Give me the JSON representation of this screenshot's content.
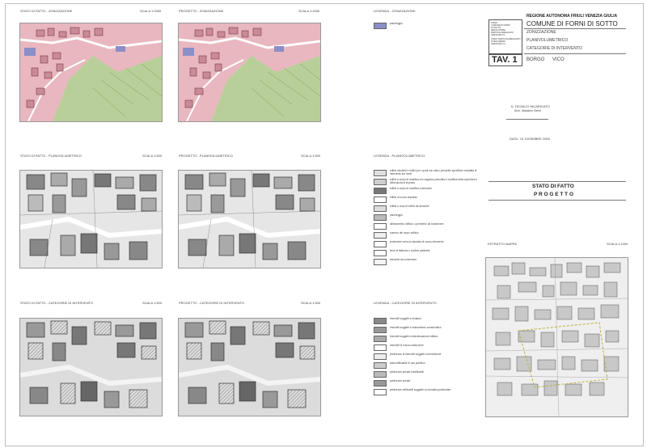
{
  "sheet": {
    "panels": {
      "zon_sf_title": "STATO DI FATTO - ZONIZZAZIONE",
      "zon_sf_scale": "SCALA 1:2000",
      "zon_pr_title": "PROGETTO - ZONIZZAZIONE",
      "zon_pr_scale": "SCALA 1:2000",
      "pv_sf_title": "STATO DI FATTO - PLANIVOLUMETRICO",
      "pv_sf_scale": "SCALA 1:500",
      "pv_pr_title": "PROGETTO - PLANIVOLUMETRICO",
      "pv_pr_scale": "SCALA 1:500",
      "ci_sf_title": "STATO DI FATTO - CATEGORIE DI INTERVENTO",
      "ci_sf_scale": "SCALA 1:500",
      "ci_pr_title": "PROGETTO - CATEGORIE DI INTERVENTO",
      "ci_pr_scale": "SCALA 1:500"
    },
    "legends": {
      "zon_title": "LEGENDA - ZONIZZAZIONE",
      "zon_items": [
        "parcheggio"
      ],
      "pv_title": "LEGENDA - PLANIVOLUMETRICO",
      "pv_items": [
        "edifici esistenti e edifici per i quali non siano prescritte specifiche modalità di intervento sui fronti",
        "edifici a corpo di modifica con sagoma prescritta e modifica della copertura e della quota di imposta",
        "edifici a corpo di modifica costruzioni",
        "edifici di nuovo impianto",
        "edifici o corpi di edifici da demolire",
        "parcheggio",
        "allineamento edificio o perimetro da mantenere",
        "numero del corpo edificio",
        "protezione verso la facciata di nuovo intervento",
        "linee di fabbrica e confine particelle",
        "elementi da conservare"
      ],
      "ci_title": "LEGENDA - CATEGORIE DI INTERVENTO",
      "ci_items": [
        "immobili soggetti a restauro",
        "immobili soggetti a risanamento conservativo",
        "immobili soggetti a ristrutturazione edilizia",
        "immobili di nuova costruzione",
        "pertinenze di immobili soggetti a demolizione",
        "area edificabile di uso pubblico",
        "pertinenze private inedificabili",
        "pertinenze private",
        "pertinenze edificabili soggette a normativa particolare"
      ]
    },
    "titleblock": {
      "logo_lines": [
        "PIANO",
        "COMUNE DI FORNI",
        "DI SOTTO",
        "REGOLATORE",
        "PARTICOLAREGGIATO",
        "VARIANTE N.1"
      ],
      "logo_lines2": [
        "PIANO PARTICOLAREGGIATO",
        "DI RECUPERO",
        "VARIANTE N.2"
      ],
      "tav": "TAV. 1",
      "region": "REGIONE AUTONOMA FRIULI VENEZIA GIULIA",
      "comune": "COMUNE DI FORNI DI SOTTO",
      "line1": "ZONIZZAZIONE",
      "line2": "PLANIVOLUMETRICO",
      "line3": "CATEGORIE DI INTERVENTO",
      "borgo": "BORGO",
      "vico": "VICO",
      "tecnico_label": "IL TECNICO INCARICATO",
      "tecnico_name": "Arch. Massimo Serini",
      "data": "DATA : 01 DICEMBRE 2000",
      "stato": "STATO DI FATTO",
      "progetto": "P R O G E T T O",
      "estratto": "ESTRATTO MAPPA",
      "estratto_scale": "SCALA 1:1000"
    }
  }
}
